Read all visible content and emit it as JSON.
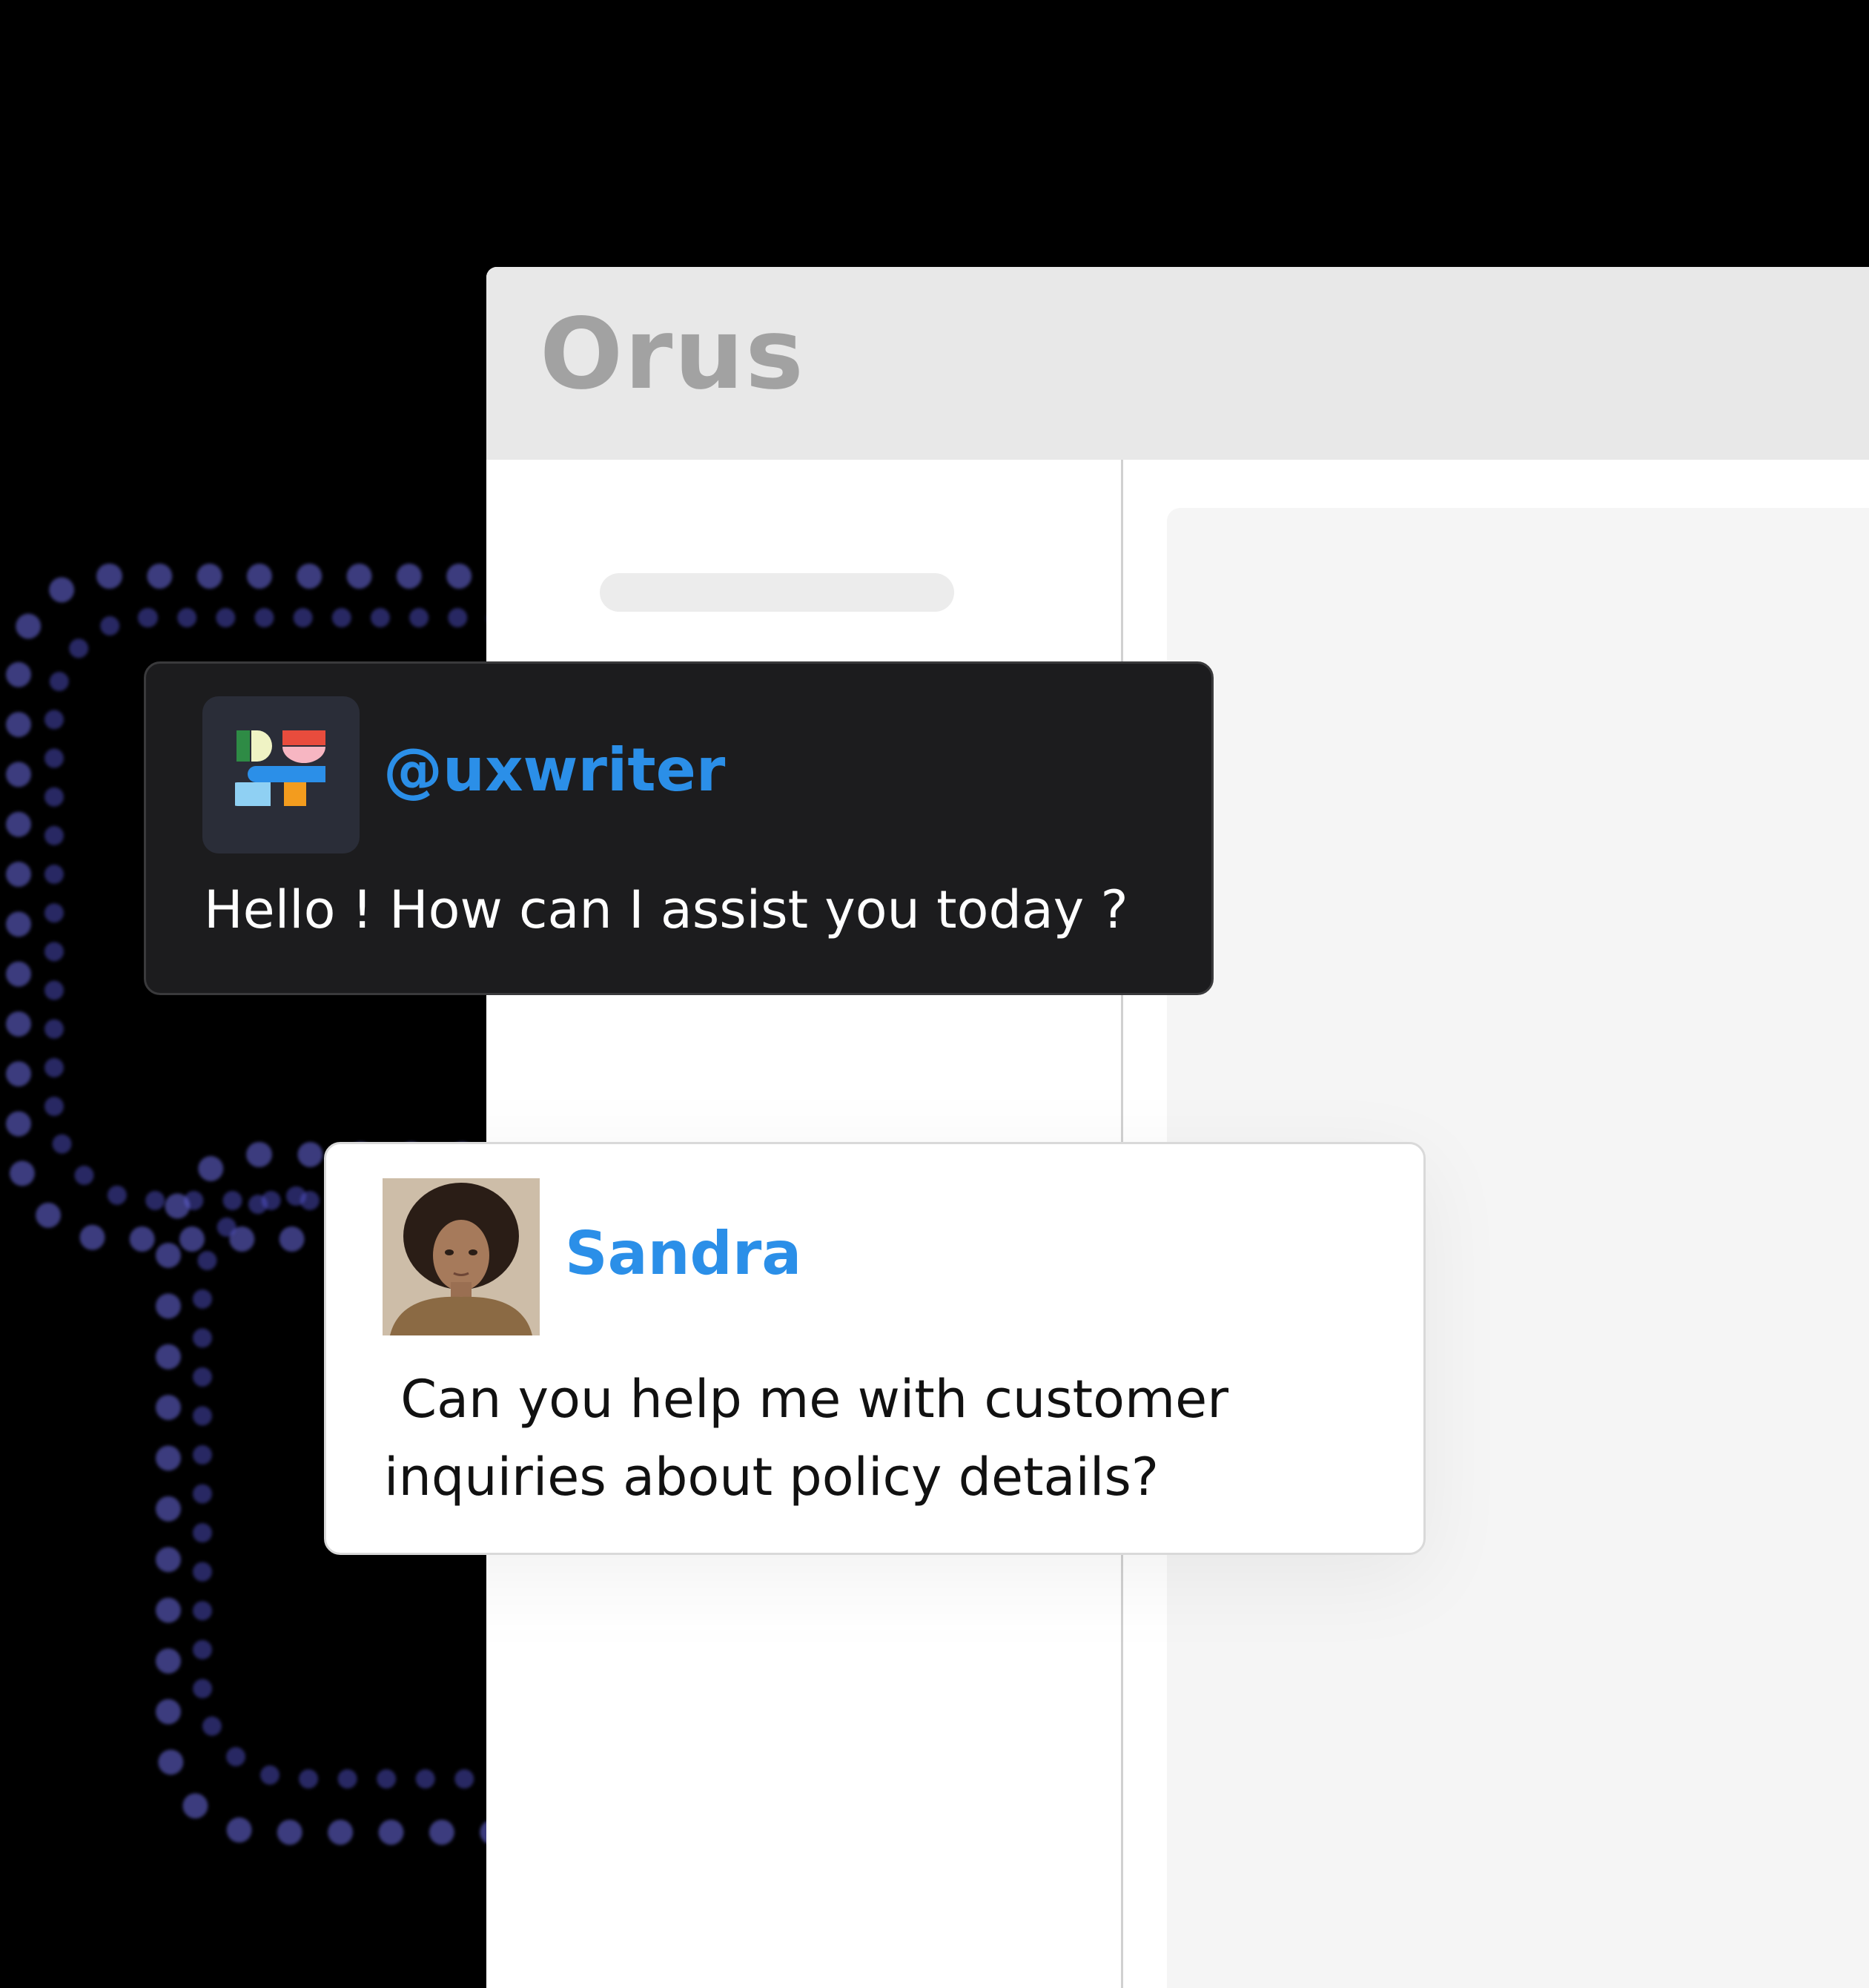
{
  "window": {
    "app_title": "Orus"
  },
  "chat": {
    "bot": {
      "handle": "@uxwriter",
      "avatar_icon": "uxwriter-logo-icon",
      "message": "Hello ! How can I assist you today ?"
    },
    "user": {
      "name": "Sandra",
      "avatar": "sandra-avatar-photo",
      "message": " Can you help me with customer\ninquiries about policy details?"
    }
  },
  "colors": {
    "accent": "#2b8fe8",
    "bot_card_bg": "#1c1c1e",
    "user_card_bg": "#ffffff",
    "titlebar_bg": "#e8e8e8",
    "glow": "#6e6ee6"
  }
}
